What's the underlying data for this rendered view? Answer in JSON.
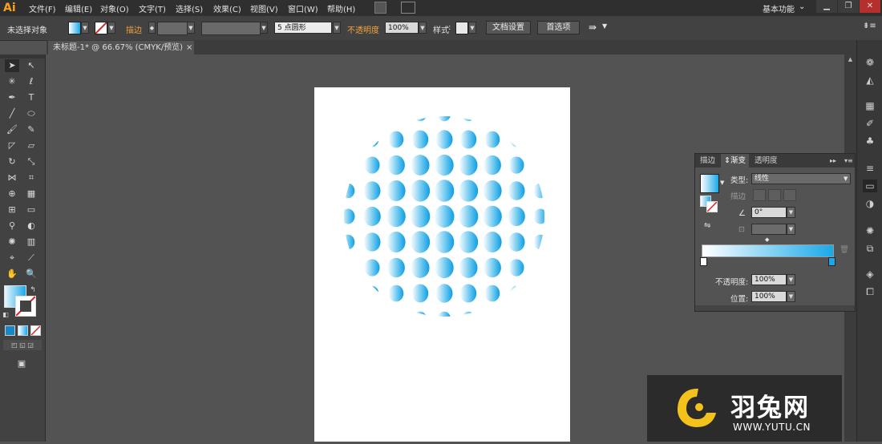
{
  "app": {
    "logo": "Ai",
    "workspace": "基本功能"
  },
  "menu": [
    "文件(F)",
    "编辑(E)",
    "对象(O)",
    "文字(T)",
    "选择(S)",
    "效果(C)",
    "视图(V)",
    "窗口(W)",
    "帮助(H)"
  ],
  "window_controls": {
    "minimize": "▁",
    "maximize": "❐",
    "close": "✕"
  },
  "control_bar": {
    "selection_status": "未选择对象",
    "stroke_label": "描边",
    "brush_label": "5 点圆形",
    "opacity_label": "不透明度",
    "opacity_value": "100%",
    "style_label": "样式",
    "doc_setup_button": "文档设置",
    "prefs_button": "首选项"
  },
  "document_tab": {
    "title": "未标题-1* @ 66.67% (CMYK/预览)",
    "close": "×"
  },
  "gradient_panel": {
    "tabs": [
      "描边",
      "渐变",
      "透明度"
    ],
    "active_tab": "渐变",
    "type_label": "类型:",
    "type_value": "线性",
    "stroke_label": "描边",
    "angle_value": "0°",
    "opacity_label": "不透明度:",
    "opacity_value": "100%",
    "location_label": "位置:",
    "location_value": "100%",
    "gradient_start": "#ffffff",
    "gradient_end": "#1aa9e8"
  },
  "artwork": {
    "colors": {
      "light": "#ffffff",
      "mid": "#7fcff2",
      "dark": "#0b9ee3"
    }
  },
  "watermark": {
    "brand": "羽兔网",
    "url": "WWW.YUTU.CN",
    "accent": "#f3c21b"
  }
}
